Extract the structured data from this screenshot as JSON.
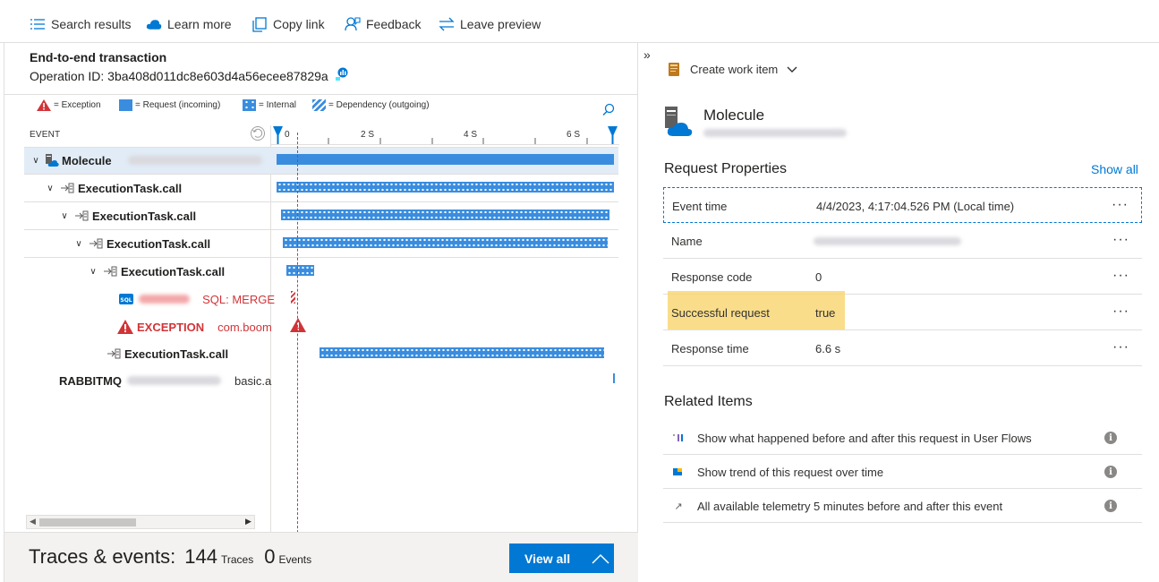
{
  "toolbar": {
    "search_results": "Search results",
    "learn_more": "Learn more",
    "copy_link": "Copy link",
    "feedback": "Feedback",
    "leave_preview": "Leave preview"
  },
  "transaction": {
    "title": "End-to-end transaction",
    "operation_id": "Operation ID: 3ba408d011dc8e603d4a56ecee87829a"
  },
  "legend": {
    "exception": "= Exception",
    "request": "= Request (incoming)",
    "internal": "= Internal",
    "dependency": "= Dependency (outgoing)"
  },
  "grid": {
    "event_header": "EVENT",
    "ticks": [
      "0",
      "2 S",
      "4 S",
      "6 S"
    ]
  },
  "rows": [
    {
      "name": "Molecule",
      "type": "request"
    },
    {
      "name": "ExecutionTask.call",
      "type": "internal"
    },
    {
      "name": "ExecutionTask.call",
      "type": "internal"
    },
    {
      "name": "ExecutionTask.call",
      "type": "internal"
    },
    {
      "name": "ExecutionTask.call",
      "type": "internal"
    },
    {
      "name": "SQL: MERGE",
      "type": "dependency"
    },
    {
      "name": "EXCEPTION",
      "detail": "com.boom",
      "type": "exception"
    },
    {
      "name": "ExecutionTask.call",
      "type": "internal"
    },
    {
      "name": "RABBITMQ",
      "detail": "basic.a",
      "type": "dependency"
    }
  ],
  "traces": {
    "label": "Traces & events:",
    "trace_count": "144",
    "trace_unit": "Traces",
    "event_count": "0",
    "event_unit": "Events",
    "view_all": "View all"
  },
  "right": {
    "collapse": "»",
    "create_work_item": "Create work item",
    "resource_name": "Molecule",
    "request_properties": "Request Properties",
    "show_all": "Show all",
    "properties": [
      {
        "label": "Event time",
        "value": "4/4/2023, 4:17:04.526 PM (Local time)"
      },
      {
        "label": "Name",
        "value": ""
      },
      {
        "label": "Response code",
        "value": "0"
      },
      {
        "label": "Successful request",
        "value": "true"
      },
      {
        "label": "Response time",
        "value": "6.6 s"
      }
    ],
    "related_items": "Related Items",
    "related": [
      {
        "text": "Show what happened before and after this request in User Flows",
        "icon": "user-flows-icon"
      },
      {
        "text": "Show trend of this request over time",
        "icon": "trend-icon"
      },
      {
        "text": "All available telemetry 5 minutes before and after this event",
        "icon": "arrow-out-icon"
      }
    ],
    "more": "···"
  },
  "colors": {
    "accent": "#0078d4",
    "bar": "#3a8dde",
    "error": "#d13438",
    "highlight": "#f8d775"
  }
}
